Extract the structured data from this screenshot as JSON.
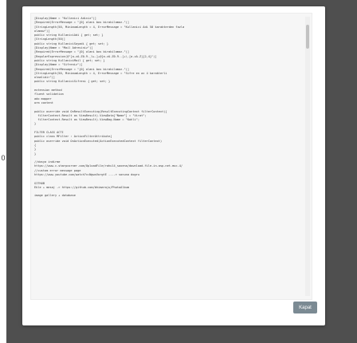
{
  "side_marker": "0",
  "modal": {
    "close_label": "Kapat",
    "code_lines": [
      "[Display(Name = \"Kullanici Adiniz\")]",
      "[Required(ErrorMessage = \"{0} alani bos birakilamaz.\")]",
      "[StringLength(50, MinimumLength = 4, ErrorMessage = \"Kullanici Adi 50 karakterden fazla",
      "olamaz\")]",
      "public string KullaniciAdi { get; set; }",
      "[StringLength(50)]",
      "public string KullaniciSoyadi { get; set; }",
      "[Display(Name = \"Mail Adresiniz\")]",
      "[Required(ErrorMessage = \"{0} alani bos birakilamaz.\")]",
      "[RegularExpression(@\"[a-zA-Z0-9._%+-]+@[a-zA-Z0-9.-]+\\.[a-zA-Z]{2,4}\")]",
      "public string KullaniciMail { get; set; }",
      "[Display(Name = \"Sifreniz\")]",
      "[Required(ErrorMessage = \"{0} alani bos birakilamaz.\")]",
      "[StringLength(50, MinimumLength = 4, ErrorMessage = \"Sifre en az 4 karakterli",
      "olmalidir\")]",
      "public string KullaniciSifresi { get; set; }",
      "",
      "extension method",
      "fluent validation",
      "ado mapper",
      "orm content",
      "",
      "public override void OnResultExecuting(ResultExecutingContext filterContext){",
      "  filterContext.Result as ViewResult).ViewData[\"Name\"] = \"Virat\";",
      "  filterContext.Result as ViewResult).ViewBag.Name = \"Kohli\";",
      "}",
      "",
      "FILTER CLASS ACTI",
      "public class MFilter : ActionFilterAttribute{",
      "public override void OnActionExecuted(ActionExecutedContext filterContext)",
      "{",
      "}",
      "}",
      "",
      "//dosya indirme",
      "https://www.c-sharpcorner.com/UploadFile/rahul4_saxena/download-file-in-asp-net-mvc-4/",
      "//custom error message page",
      "https://www.youtube.com/watch?v=NgwsVorgtE ----> sonuna dogru",
      "",
      "GITHUB",
      "Ekle + mesaj -> https://github.com/bhimaraju/PhotoAlbum",
      "",
      "image gallery + database"
    ]
  }
}
